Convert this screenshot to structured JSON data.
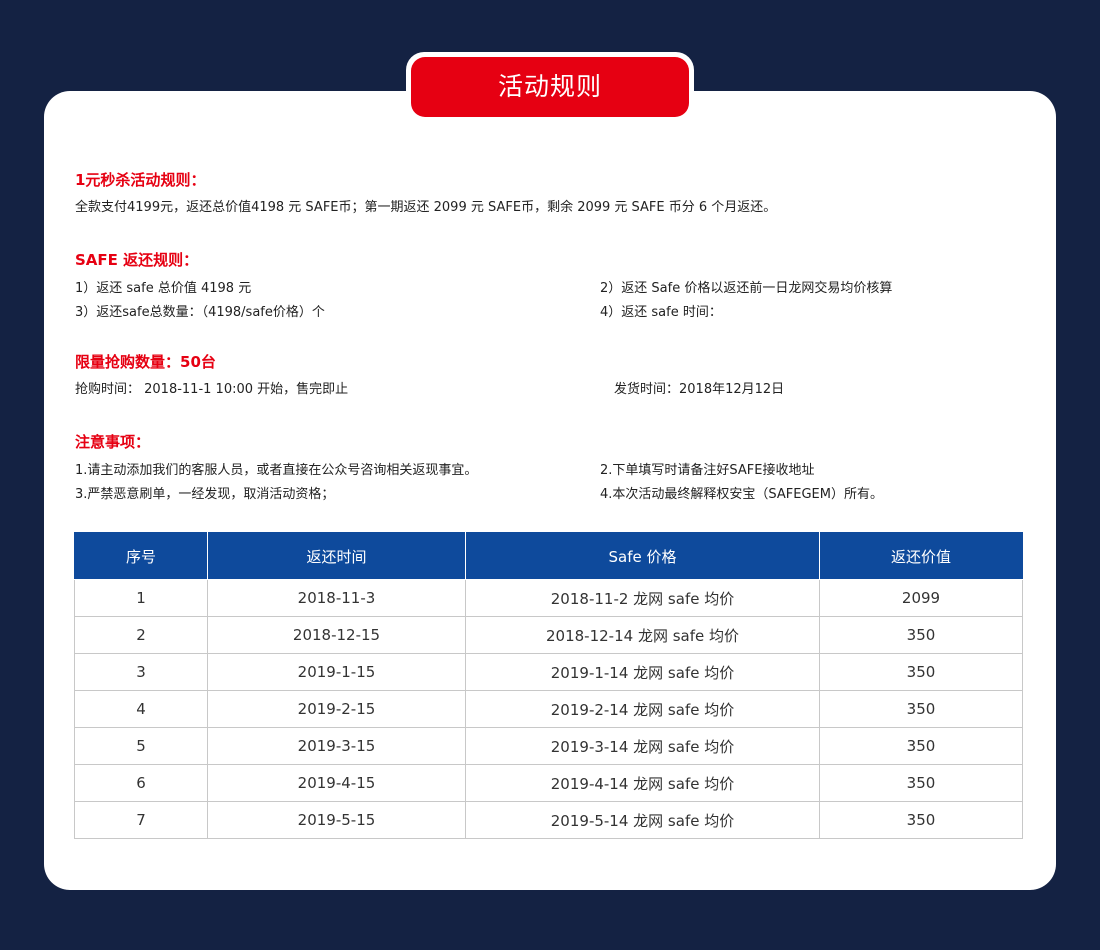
{
  "header": {
    "title": "活动规则"
  },
  "flash_sale": {
    "title": "1元秒杀活动规则：",
    "desc": "全款支付4199元，返还总价值4198 元 SAFE币；第一期返还 2099 元 SAFE币，剩余 2099 元 SAFE 币分 6 个月返还。"
  },
  "safe_rules": {
    "title": "SAFE 返还规则：",
    "item1": "1）返还 safe 总价值 4198 元",
    "item2": "2）返还 Safe 价格以返还前一日龙网交易均价核算",
    "item3": "3）返还safe总数量：（4198/safe价格）个",
    "item4": "4）返还 safe 时间："
  },
  "limit": {
    "title": "限量抢购数量：50台",
    "buy_time": "抢购时间： 2018-11-1 10:00 开始，售完即止",
    "ship_time": "发货时间：2018年12月12日"
  },
  "notes": {
    "title": "注意事项：",
    "item1": "1.请主动添加我们的客服人员，或者直接在公众号咨询相关返现事宜。",
    "item2": "2.下单填写时请备注好SAFE接收地址",
    "item3": "3.严禁恶意刷单，一经发现，取消活动资格；",
    "item4": "4.本次活动最终解释权安宝（SAFEGEM）所有。"
  },
  "table": {
    "headers": [
      "序号",
      "返还时间",
      "Safe 价格",
      "返还价值"
    ],
    "rows": [
      [
        "1",
        "2018-11-3",
        "2018-11-2 龙网 safe 均价",
        "2099"
      ],
      [
        "2",
        "2018-12-15",
        "2018-12-14 龙网 safe 均价",
        "350"
      ],
      [
        "3",
        "2019-1-15",
        "2019-1-14 龙网 safe 均价",
        "350"
      ],
      [
        "4",
        "2019-2-15",
        "2019-2-14 龙网 safe 均价",
        "350"
      ],
      [
        "5",
        "2019-3-15",
        "2019-3-14 龙网 safe 均价",
        "350"
      ],
      [
        "6",
        "2019-4-15",
        "2019-4-14 龙网 safe 均价",
        "350"
      ],
      [
        "7",
        "2019-5-15",
        "2019-5-14 龙网 safe 均价",
        "350"
      ]
    ]
  },
  "colors": {
    "background": "#142243",
    "accent_red": "#e60012",
    "table_header_blue": "#0e4a9c"
  }
}
